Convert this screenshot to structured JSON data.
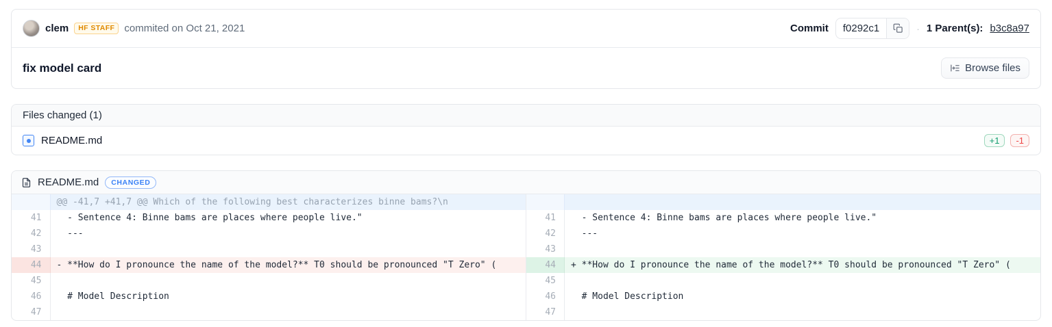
{
  "commit_header": {
    "author": "clem",
    "staff_badge": "HF STAFF",
    "commit_date_text": "commited on Oct 21, 2021",
    "commit_label": "Commit",
    "commit_hash": "f0292c1",
    "separator_dot": "·",
    "parents_label": "1 Parent(s):",
    "parent_hash": "b3c8a97",
    "title": "fix model card",
    "browse_files_label": "Browse files"
  },
  "files_changed": {
    "header": "Files changed (1)",
    "files": [
      {
        "name": "README.md",
        "additions": "+1",
        "deletions": "-1"
      }
    ]
  },
  "diff": {
    "file_name": "README.md",
    "status_badge": "CHANGED",
    "hunk_header": "@@ -41,7 +41,7 @@ Which of the following best characterizes binne bams?\\n",
    "rows": [
      {
        "num": "41",
        "left": {
          "kind": "context",
          "text": "  - Sentence 4: Binne bams are places where people live.\""
        },
        "right": {
          "kind": "context",
          "text": "  - Sentence 4: Binne bams are places where people live.\""
        }
      },
      {
        "num": "42",
        "left": {
          "kind": "context",
          "text": "  ---"
        },
        "right": {
          "kind": "context",
          "text": "  ---"
        }
      },
      {
        "num": "43",
        "left": {
          "kind": "context",
          "text": ""
        },
        "right": {
          "kind": "context",
          "text": ""
        }
      },
      {
        "num": "44",
        "left": {
          "kind": "del",
          "text": "- **How do I pronounce the name of the model?** T0 should be pronounced \"T Zero\" ("
        },
        "right": {
          "kind": "add",
          "text": "+ **How do I pronounce the name of the model?** T0 should be pronounced \"T Zero\" ("
        }
      },
      {
        "num": "45",
        "left": {
          "kind": "context",
          "text": ""
        },
        "right": {
          "kind": "context",
          "text": ""
        }
      },
      {
        "num": "46",
        "left": {
          "kind": "context",
          "text": "  # Model Description"
        },
        "right": {
          "kind": "context",
          "text": "  # Model Description"
        }
      },
      {
        "num": "47",
        "left": {
          "kind": "context",
          "text": ""
        },
        "right": {
          "kind": "context",
          "text": ""
        }
      }
    ]
  },
  "icons": {
    "copy_icon": "copy",
    "browse_files_icon": "indent-list-arrow",
    "modified_file_icon": "square-dot",
    "document_icon": "file-lines"
  },
  "colors": {
    "accent_blue": "#4285f4",
    "addition_green": "#0f9d6e",
    "deletion_red": "#ef4444",
    "staff_amber": "#e08a00",
    "hunk_blue_bg": "#eaf3fd",
    "del_bg": "#fdf0ee",
    "add_bg": "#edf9f1"
  }
}
